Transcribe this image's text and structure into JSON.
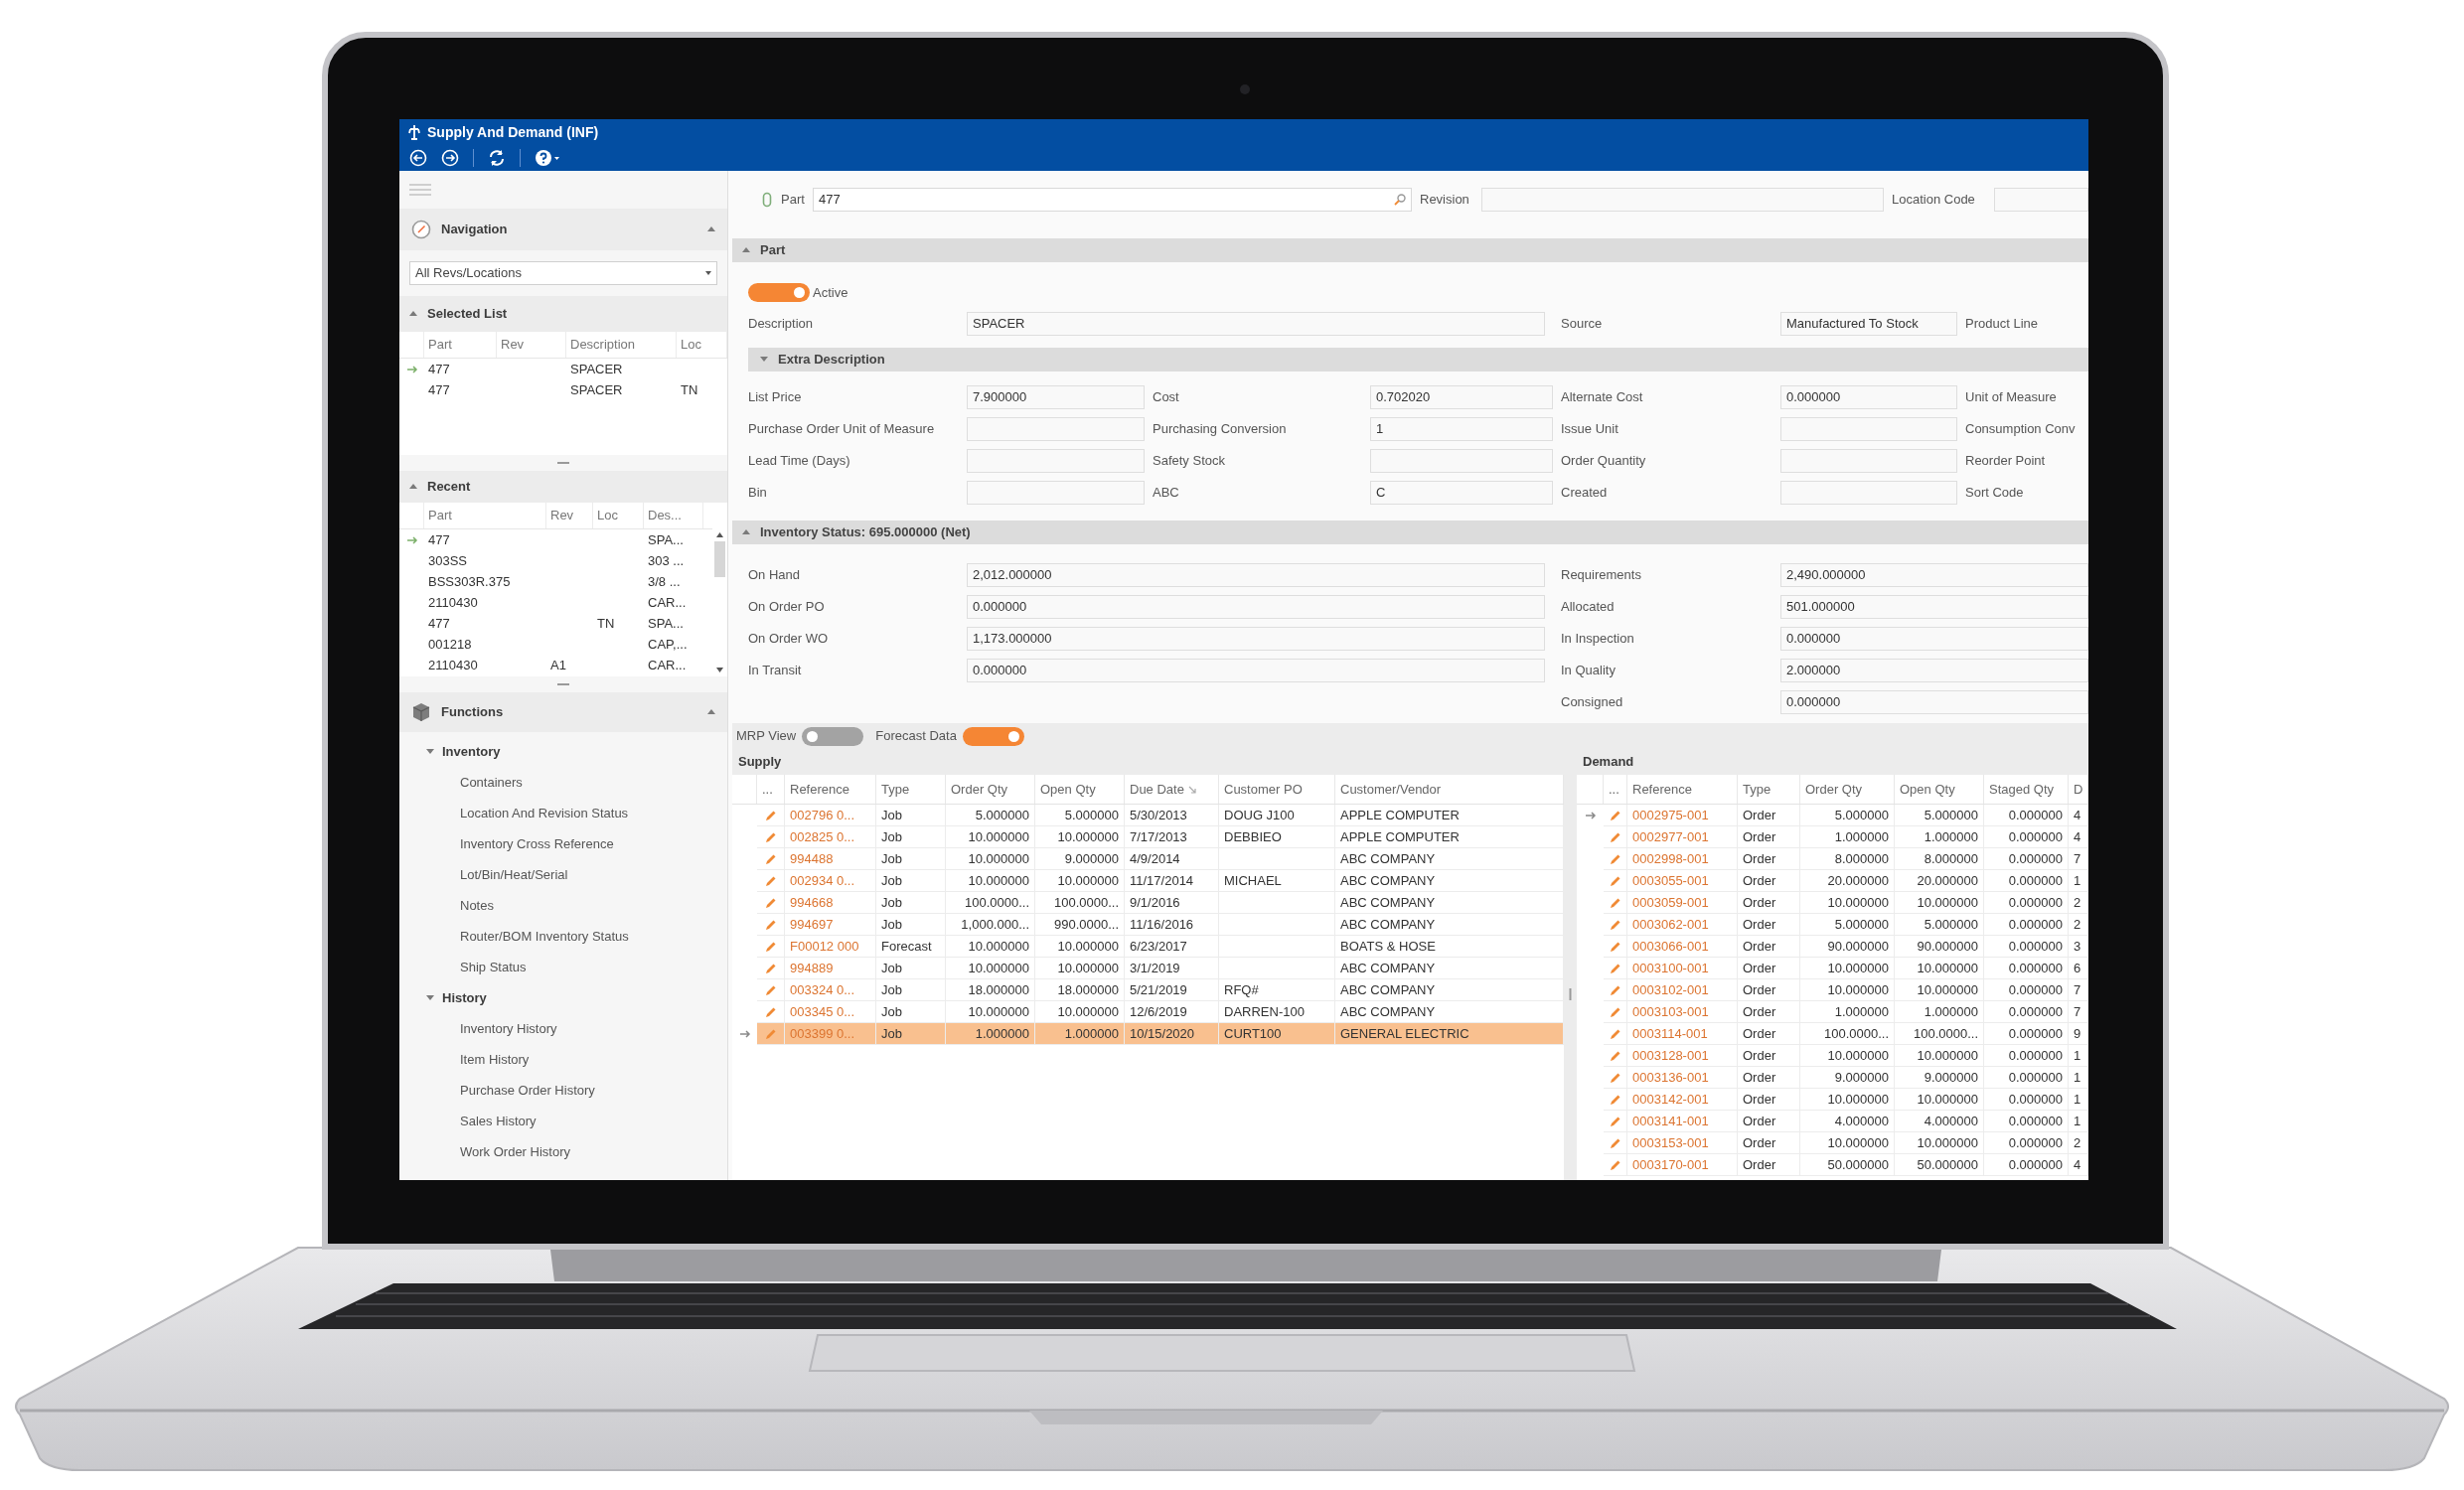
{
  "window": {
    "title": "Supply And Demand (INF)"
  },
  "sidebar": {
    "navigation": {
      "title": "Navigation",
      "expanded": true,
      "dropdown": "All Revs/Locations"
    },
    "selected_list": {
      "title": "Selected List",
      "expanded": true,
      "columns": [
        "Part",
        "Rev",
        "Description",
        "Loc"
      ],
      "rows": [
        {
          "part": "477",
          "description": "SPACER",
          "current": true
        },
        {
          "part": "477",
          "description": "SPACER",
          "loc": "TN",
          "current": false
        }
      ]
    },
    "recent": {
      "title": "Recent",
      "expanded": true,
      "columns": [
        "Part",
        "Rev",
        "Loc",
        "Des..."
      ],
      "rows": [
        {
          "part": "477",
          "des": "SPA...",
          "current": true
        },
        {
          "part": "303SS",
          "des": "303 ...",
          "current": false
        },
        {
          "part": "BSS303R.375",
          "des": "3/8 ...",
          "current": false
        },
        {
          "part": "2110430",
          "des": "CAR...",
          "current": false
        },
        {
          "part": "477",
          "loc": "TN",
          "des": "SPA...",
          "current": false
        },
        {
          "part": "001218",
          "des": "CAP,...",
          "current": false
        },
        {
          "part": "2110430",
          "rev": "A1",
          "des": "CAR...",
          "current": false
        }
      ]
    },
    "functions": {
      "title": "Functions",
      "expanded": true,
      "groups": [
        {
          "label": "Inventory",
          "expanded": true,
          "children": [
            {
              "label": "Containers"
            },
            {
              "label": "Location And Revision Status"
            },
            {
              "label": "Inventory Cross Reference"
            },
            {
              "label": "Lot/Bin/Heat/Serial"
            },
            {
              "label": "Notes"
            },
            {
              "label": "Router/BOM Inventory Status"
            },
            {
              "label": "Ship Status"
            }
          ]
        },
        {
          "label": "History",
          "expanded": true,
          "children": [
            {
              "label": "Inventory History"
            },
            {
              "label": "Item History"
            },
            {
              "label": "Purchase Order History"
            },
            {
              "label": "Sales History"
            },
            {
              "label": "Work Order History"
            }
          ]
        }
      ]
    }
  },
  "main": {
    "lookup": {
      "part_label": "Part",
      "part_value": "477",
      "revision_label": "Revision",
      "location_label": "Location Code"
    },
    "part_section": {
      "title": "Part",
      "expanded": true,
      "active": {
        "label": "Active",
        "on": true
      },
      "description": {
        "label": "Description",
        "value": "SPACER"
      },
      "source": {
        "label": "Source",
        "value": "Manufactured To Stock"
      },
      "product_line_label": "Product Line",
      "extra_description": {
        "title": "Extra Description",
        "expanded": true,
        "rows": [
          [
            {
              "label": "List Price",
              "value": "7.900000"
            },
            {
              "label": "Cost",
              "value": "0.702020"
            },
            {
              "label": "Alternate Cost",
              "value": "0.000000"
            },
            {
              "label": "Unit of Measure"
            }
          ],
          [
            {
              "label": "Purchase Order Unit of Measure"
            },
            {
              "label": "Purchasing Conversion",
              "value": "1"
            },
            {
              "label": "Issue Unit"
            },
            {
              "label": "Consumption Conv"
            }
          ],
          [
            {
              "label": "Lead Time (Days)"
            },
            {
              "label": "Safety Stock"
            },
            {
              "label": "Order Quantity"
            },
            {
              "label": "Reorder Point"
            }
          ],
          [
            {
              "label": "Bin"
            },
            {
              "label": "ABC",
              "value": "C"
            },
            {
              "label": "Created"
            },
            {
              "label": "Sort Code"
            }
          ]
        ]
      }
    },
    "inventory_status": {
      "title": "Inventory Status: 695.000000 (Net)",
      "expanded": true,
      "left": [
        {
          "label": "On Hand",
          "value": "2,012.000000"
        },
        {
          "label": "On Order PO",
          "value": "0.000000"
        },
        {
          "label": "On Order WO",
          "value": "1,173.000000"
        },
        {
          "label": "In Transit",
          "value": "0.000000"
        }
      ],
      "right": [
        {
          "label": "Requirements",
          "value": "2,490.000000"
        },
        {
          "label": "Allocated",
          "value": "501.000000"
        },
        {
          "label": "In Inspection",
          "value": "0.000000"
        },
        {
          "label": "In Quality",
          "value": "2.000000"
        },
        {
          "label": "Consigned",
          "value": "0.000000"
        }
      ]
    },
    "mrp_view": {
      "label": "MRP View",
      "on": false
    },
    "forecast_data": {
      "label": "Forecast Data",
      "on": true
    },
    "supply": {
      "title": "Supply",
      "columns": [
        {
          "label": "..."
        },
        {
          "label": "Reference"
        },
        {
          "label": "Type"
        },
        {
          "label": "Order Qty"
        },
        {
          "label": "Open Qty"
        },
        {
          "label": "Due Date",
          "sorted": true
        },
        {
          "label": "Customer PO"
        },
        {
          "label": "Customer/Vendor"
        }
      ],
      "rows": [
        {
          "reference": "002796 0...",
          "type": "Job",
          "order_qty": "5.000000",
          "open_qty": "5.000000",
          "due_date": "5/30/2013",
          "customer_po": "DOUG J100",
          "customer_vendor": "APPLE COMPUTER",
          "current": false,
          "selected": false
        },
        {
          "reference": "002825 0...",
          "type": "Job",
          "order_qty": "10.000000",
          "open_qty": "10.000000",
          "due_date": "7/17/2013",
          "customer_po": "DEBBIEO",
          "customer_vendor": "APPLE COMPUTER",
          "current": false,
          "selected": false
        },
        {
          "reference": "994488",
          "type": "Job",
          "order_qty": "10.000000",
          "open_qty": "9.000000",
          "due_date": "4/9/2014",
          "customer_vendor": "ABC COMPANY",
          "current": false,
          "selected": false
        },
        {
          "reference": "002934 0...",
          "type": "Job",
          "order_qty": "10.000000",
          "open_qty": "10.000000",
          "due_date": "11/17/2014",
          "customer_po": "MICHAEL",
          "customer_vendor": "ABC COMPANY",
          "current": false,
          "selected": false
        },
        {
          "reference": "994668",
          "type": "Job",
          "order_qty": "100.0000...",
          "open_qty": "100.0000...",
          "due_date": "9/1/2016",
          "customer_vendor": "ABC COMPANY",
          "current": false,
          "selected": false
        },
        {
          "reference": "994697",
          "type": "Job",
          "order_qty": "1,000.000...",
          "open_qty": "990.0000...",
          "due_date": "11/16/2016",
          "customer_vendor": "ABC COMPANY",
          "current": false,
          "selected": false
        },
        {
          "reference": "F00012 000",
          "type": "Forecast",
          "order_qty": "10.000000",
          "open_qty": "10.000000",
          "due_date": "6/23/2017",
          "customer_vendor": "BOATS & HOSE",
          "current": false,
          "selected": false
        },
        {
          "reference": "994889",
          "type": "Job",
          "order_qty": "10.000000",
          "open_qty": "10.000000",
          "due_date": "3/1/2019",
          "customer_vendor": "ABC COMPANY",
          "current": false,
          "selected": false
        },
        {
          "reference": "003324 0...",
          "type": "Job",
          "order_qty": "18.000000",
          "open_qty": "18.000000",
          "due_date": "5/21/2019",
          "customer_po": "RFQ#",
          "customer_vendor": "ABC COMPANY",
          "current": false,
          "selected": false
        },
        {
          "reference": "003345 0...",
          "type": "Job",
          "order_qty": "10.000000",
          "open_qty": "10.000000",
          "due_date": "12/6/2019",
          "customer_po": "DARREN-100",
          "customer_vendor": "ABC COMPANY",
          "current": false,
          "selected": false
        },
        {
          "reference": "003399 0...",
          "type": "Job",
          "order_qty": "1.000000",
          "open_qty": "1.000000",
          "due_date": "10/15/2020",
          "customer_po": "CURT100",
          "customer_vendor": "GENERAL ELECTRIC",
          "current": true,
          "selected": true
        }
      ]
    },
    "demand": {
      "title": "Demand",
      "columns": [
        {
          "label": "..."
        },
        {
          "label": "Reference"
        },
        {
          "label": "Type"
        },
        {
          "label": "Order Qty"
        },
        {
          "label": "Open Qty"
        },
        {
          "label": "Staged Qty"
        },
        {
          "label": "D"
        }
      ],
      "rows": [
        {
          "reference": "0002975-001",
          "type": "Order",
          "order_qty": "5.000000",
          "open_qty": "5.000000",
          "staged_qty": "0.000000",
          "column_7": "4",
          "current": true
        },
        {
          "reference": "0002977-001",
          "type": "Order",
          "order_qty": "1.000000",
          "open_qty": "1.000000",
          "staged_qty": "0.000000",
          "column_7": "4",
          "current": false
        },
        {
          "reference": "0002998-001",
          "type": "Order",
          "order_qty": "8.000000",
          "open_qty": "8.000000",
          "staged_qty": "0.000000",
          "column_7": "7",
          "current": false
        },
        {
          "reference": "0003055-001",
          "type": "Order",
          "order_qty": "20.000000",
          "open_qty": "20.000000",
          "staged_qty": "0.000000",
          "column_7": "1",
          "current": false
        },
        {
          "reference": "0003059-001",
          "type": "Order",
          "order_qty": "10.000000",
          "open_qty": "10.000000",
          "staged_qty": "0.000000",
          "column_7": "2",
          "current": false
        },
        {
          "reference": "0003062-001",
          "type": "Order",
          "order_qty": "5.000000",
          "open_qty": "5.000000",
          "staged_qty": "0.000000",
          "column_7": "2",
          "current": false
        },
        {
          "reference": "0003066-001",
          "type": "Order",
          "order_qty": "90.000000",
          "open_qty": "90.000000",
          "staged_qty": "0.000000",
          "column_7": "3",
          "current": false
        },
        {
          "reference": "0003100-001",
          "type": "Order",
          "order_qty": "10.000000",
          "open_qty": "10.000000",
          "staged_qty": "0.000000",
          "column_7": "6",
          "current": false
        },
        {
          "reference": "0003102-001",
          "type": "Order",
          "order_qty": "10.000000",
          "open_qty": "10.000000",
          "staged_qty": "0.000000",
          "column_7": "7",
          "current": false
        },
        {
          "reference": "0003103-001",
          "type": "Order",
          "order_qty": "1.000000",
          "open_qty": "1.000000",
          "staged_qty": "0.000000",
          "column_7": "7",
          "current": false
        },
        {
          "reference": "0003114-001",
          "type": "Order",
          "order_qty": "100.0000...",
          "open_qty": "100.0000...",
          "staged_qty": "0.000000",
          "column_7": "9",
          "current": false
        },
        {
          "reference": "0003128-001",
          "type": "Order",
          "order_qty": "10.000000",
          "open_qty": "10.000000",
          "staged_qty": "0.000000",
          "column_7": "1",
          "current": false
        },
        {
          "reference": "0003136-001",
          "type": "Order",
          "order_qty": "9.000000",
          "open_qty": "9.000000",
          "staged_qty": "0.000000",
          "column_7": "1",
          "current": false
        },
        {
          "reference": "0003142-001",
          "type": "Order",
          "order_qty": "10.000000",
          "open_qty": "10.000000",
          "staged_qty": "0.000000",
          "column_7": "1",
          "current": false
        },
        {
          "reference": "0003141-001",
          "type": "Order",
          "order_qty": "4.000000",
          "open_qty": "4.000000",
          "staged_qty": "0.000000",
          "column_7": "1",
          "current": false
        },
        {
          "reference": "0003153-001",
          "type": "Order",
          "order_qty": "10.000000",
          "open_qty": "10.000000",
          "staged_qty": "0.000000",
          "column_7": "2",
          "current": false
        },
        {
          "reference": "0003170-001",
          "type": "Order",
          "order_qty": "50.000000",
          "open_qty": "50.000000",
          "staged_qty": "0.000000",
          "column_7": "4",
          "current": false
        }
      ]
    }
  }
}
